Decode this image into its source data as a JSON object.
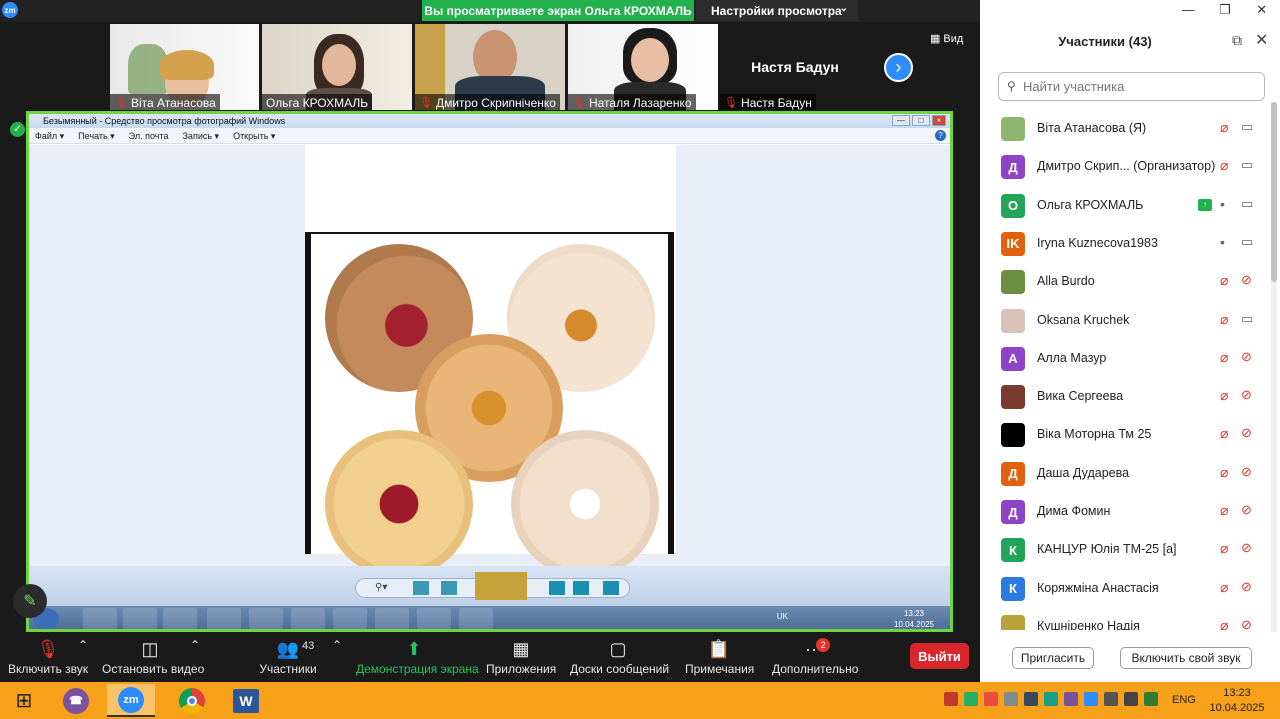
{
  "zoom_top": {
    "logo": "zm",
    "share_banner": "Вы просматриваете экран Ольга КРОХМАЛЬ",
    "view_settings": "Настройки просмотра"
  },
  "video_strip": {
    "tiles": [
      {
        "name": "Віта Атанасова"
      },
      {
        "name": "Ольга КРОХМАЛЬ"
      },
      {
        "name": "Дмитро Скрипніченко"
      },
      {
        "name": "Наталя Лазаренко"
      },
      {
        "name": "Настя Бадун"
      }
    ],
    "text_tile_name": "Настя Бадун",
    "view_label": "Вид"
  },
  "photo_viewer": {
    "title": "Безымянный - Средство просмотра фотографий Windows",
    "menu": [
      "Файл ▾",
      "Печать ▾",
      "Эл. почта",
      "Запись ▾",
      "Открыть ▾"
    ],
    "tray_lang": "UK",
    "clock_time": "13:23",
    "clock_date": "10.04.2025"
  },
  "controls": {
    "audio": "Включить звук",
    "video": "Остановить видео",
    "participants": "Участники",
    "participants_count": "43",
    "share": "Демонстрация экрана",
    "apps": "Приложения",
    "boards": "Доски сообщений",
    "notes": "Примечания",
    "more": "Дополнительно",
    "more_badge": "2",
    "leave": "Выйти"
  },
  "panel": {
    "title": "Участники (43)",
    "search_placeholder": "Найти участника",
    "participants": [
      {
        "name": "Віта Атанасова (Я)",
        "avatar": "",
        "color": "#8fb573",
        "mic": "muted",
        "cam": "on"
      },
      {
        "name": "Дмитро Скрип...   (Организатор)",
        "avatar": "Д",
        "color": "#8e44c7",
        "mic": "muted",
        "cam": "on"
      },
      {
        "name": "Ольга КРОХМАЛЬ",
        "avatar": "О",
        "color": "#23a559",
        "mic": "on",
        "cam": "on",
        "sharing": true
      },
      {
        "name": "Iryna Kuznecova1983",
        "avatar": "IK",
        "color": "#e0620f",
        "mic": "on",
        "cam": "on"
      },
      {
        "name": "Alla Burdo",
        "avatar": "",
        "color": "#6b8f3e",
        "mic": "muted",
        "cam": "off"
      },
      {
        "name": "Oksana Kruchek",
        "avatar": "",
        "color": "#d9c2b8",
        "mic": "muted",
        "cam": "on"
      },
      {
        "name": "Алла Мазур",
        "avatar": "А",
        "color": "#8e44c7",
        "mic": "muted",
        "cam": "off"
      },
      {
        "name": "Вика Сергеева",
        "avatar": "",
        "color": "#7a3b2e",
        "mic": "muted",
        "cam": "off"
      },
      {
        "name": "Віка Моторна Тм 25",
        "avatar": "",
        "color": "#000000",
        "mic": "muted",
        "cam": "off"
      },
      {
        "name": "Даша Дударева",
        "avatar": "Д",
        "color": "#e0620f",
        "mic": "muted",
        "cam": "off"
      },
      {
        "name": "Дима Фомин",
        "avatar": "Д",
        "color": "#8e44c7",
        "mic": "muted",
        "cam": "off"
      },
      {
        "name": "КАНЦУР Юлія ТМ-25 [а]",
        "avatar": "К",
        "color": "#23a559",
        "mic": "muted",
        "cam": "off"
      },
      {
        "name": "Коряжміна Анастасія",
        "avatar": "К",
        "color": "#2d7be0",
        "mic": "muted",
        "cam": "off"
      },
      {
        "name": "Кушніренко Надія",
        "avatar": "",
        "color": "#b8a23a",
        "mic": "muted",
        "cam": "off"
      }
    ],
    "invite": "Пригласить",
    "unmute_self": "Включить свой звук"
  },
  "taskbar": {
    "lang": "ENG",
    "time": "13:23",
    "date": "10.04.2025",
    "zoom_label": "zm"
  }
}
